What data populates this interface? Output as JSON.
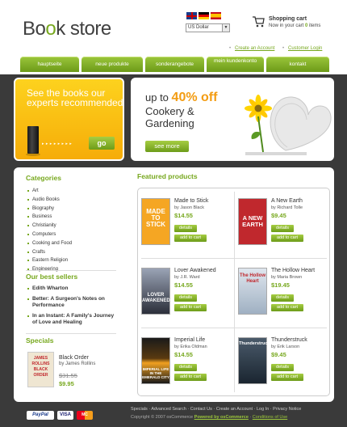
{
  "header": {
    "logo_part1": "Bo",
    "logo_part2": "o",
    "logo_part3": "k store",
    "currency": "US Dollar",
    "cart_title": "Shopping cart",
    "cart_text": "Now in your cart",
    "cart_count": "0",
    "cart_items_label": "items",
    "link_create": "Create an Account",
    "link_login": "Customer Login"
  },
  "nav": {
    "tabs": [
      "hauptseite",
      "neue produkte",
      "sonderangebote",
      "mein kundenkonto",
      "kontakt"
    ]
  },
  "banner_left": {
    "text": "See the books our experts recommended",
    "dots": "▸ ▸ ▸ ▸ ▸ ▸ ▸ ▸",
    "button": "go"
  },
  "banner_right": {
    "line1_prefix": "up to",
    "percent": "40% off",
    "line2": "Cookery & Gardening",
    "button": "see more"
  },
  "sidebar": {
    "categories_heading": "Categories",
    "categories": [
      "Art",
      "Audio Books",
      "Biography",
      "Business",
      "Christianity",
      "Computers",
      "Cooking and Food",
      "Crafts",
      "Eastern Religion",
      "Engineering"
    ],
    "best_heading": "Our best sellers",
    "best_sellers": [
      "Edith Wharton",
      "Better: A Surgeon's Notes on Performance",
      "In an Instant: A Family's Journey of Love and Healing"
    ],
    "specials_heading": "Specials",
    "special": {
      "title": "Black Order",
      "author": "by James Rollins",
      "old_price": "$31.55",
      "new_price": "$9.95",
      "cover_text": "JAMES ROLLINS BLACK ORDER"
    }
  },
  "featured": {
    "heading": "Featured products",
    "details_label": "details",
    "cart_label": "add to cart",
    "products": [
      {
        "title": "Made to Stick",
        "author": "by Jason Black",
        "price": "$14.55",
        "cover_text": "MADE TO STICK",
        "cover_color": "#f5a623"
      },
      {
        "title": "A New Earth",
        "author": "by Richard Tolle",
        "price": "$9.45",
        "cover_text": "A NEW EARTH",
        "cover_color": "#c0282d"
      },
      {
        "title": "Lover Awakened",
        "author": "by J.R. Ward",
        "price": "$14.55",
        "cover_text": "LOVER AWAKENED",
        "cover_color": "#2b2f3a"
      },
      {
        "title": "The Hollow Heart",
        "author": "by Maria Brown",
        "price": "$19.45",
        "cover_text": "The Hollow Heart",
        "cover_color": "#b8c6d6"
      },
      {
        "title": "Imperial Life",
        "author": "by Erika Oldman",
        "price": "$14.55",
        "cover_text": "IMPERIAL LIFE IN THE EMERALD CITY",
        "cover_color": "#1a1a1a"
      },
      {
        "title": "Thunderstruck",
        "author": "by Erik Larson",
        "price": "$9.45",
        "cover_text": "Thunderstruck",
        "cover_color": "#22313f"
      }
    ]
  },
  "footer": {
    "links": [
      "Specials",
      "Advanced Search",
      "Contact Us",
      "Create an Account",
      "Log In",
      "Privacy Notice"
    ],
    "copyright": "Copyright © 2007 osCommerce",
    "powered": "Powered by osCommerce",
    "conditions": "Conditions of Use",
    "pay_labels": [
      "PayPal",
      "VISA",
      "MC"
    ]
  }
}
